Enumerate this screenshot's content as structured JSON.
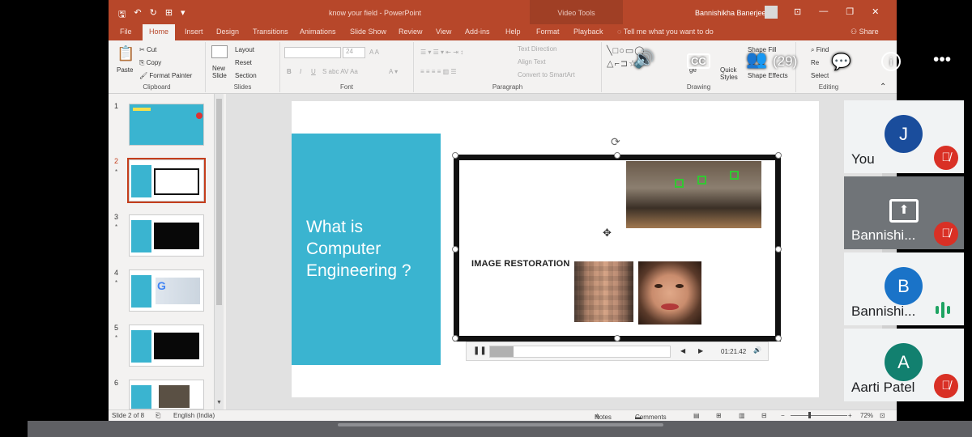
{
  "window": {
    "doc_title": "know your field  -  PowerPoint",
    "context_tab": "Video Tools",
    "user": "Bannishikha Banerjee",
    "qat": [
      "🖫",
      "↶",
      "↻",
      "⊞",
      "▾"
    ],
    "controls": [
      "⊡",
      "—",
      "❐",
      "✕"
    ]
  },
  "tabs": [
    "File",
    "Home",
    "Insert",
    "Design",
    "Transitions",
    "Animations",
    "Slide Show",
    "Review",
    "View",
    "Add-ins",
    "Help",
    "Format",
    "Playback"
  ],
  "tell_me": "Tell me what you want to do",
  "share": "Share",
  "ribbon": {
    "clipboard": {
      "paste": "Paste",
      "cut": "Cut",
      "copy": "Copy",
      "format_painter": "Format Painter",
      "name": "Clipboard"
    },
    "slides": {
      "new_slide": "New Slide",
      "layout": "Layout",
      "reset": "Reset",
      "section": "Section",
      "name": "Slides"
    },
    "font": {
      "size": "24",
      "name": "Font"
    },
    "paragraph": {
      "text_direction": "Text Direction",
      "align_text": "Align Text",
      "smartart": "Convert to SmartArt",
      "name": "Paragraph"
    },
    "drawing": {
      "shape_fill": "Shape Fill",
      "shape_effects": "Shape Effects",
      "quick_styles": "Quick Styles",
      "arrange": "ge",
      "name": "Drawing"
    },
    "editing": {
      "find": "Find",
      "replace": "Re",
      "select": "Select",
      "name": "Editing"
    }
  },
  "thumbnails": [
    {
      "num": "1",
      "star": ""
    },
    {
      "num": "2",
      "star": "*"
    },
    {
      "num": "3",
      "star": "*"
    },
    {
      "num": "4",
      "star": "*"
    },
    {
      "num": "5",
      "star": "*"
    },
    {
      "num": "6",
      "star": ""
    }
  ],
  "slide": {
    "title": "What is Computer Engineering ?",
    "image_label": "IMAGE RESTORATION"
  },
  "player": {
    "time": "01:21.42",
    "progress_fraction": 0.13
  },
  "status": {
    "slide_of": "Slide 2 of 8",
    "language": "English (India)",
    "notes": "Notes",
    "comments": "Comments",
    "zoom": "72%"
  },
  "meet": {
    "participant_count": "(29)",
    "icons": [
      "volume-icon",
      "captions-icon",
      "people-icon",
      "chat-icon",
      "info-icon",
      "more-icon"
    ],
    "participants": [
      {
        "initial": "J",
        "name": "You",
        "color": "#1a4d9c",
        "state": "muted"
      },
      {
        "initial": "",
        "name": "Bannishi...",
        "color": "#707478",
        "state": "muted-presenting"
      },
      {
        "initial": "B",
        "name": "Bannishi...",
        "color": "#1a73c8",
        "state": "speaking"
      },
      {
        "initial": "A",
        "name": "Aarti Patel",
        "color": "#12806f",
        "state": "muted"
      }
    ]
  }
}
